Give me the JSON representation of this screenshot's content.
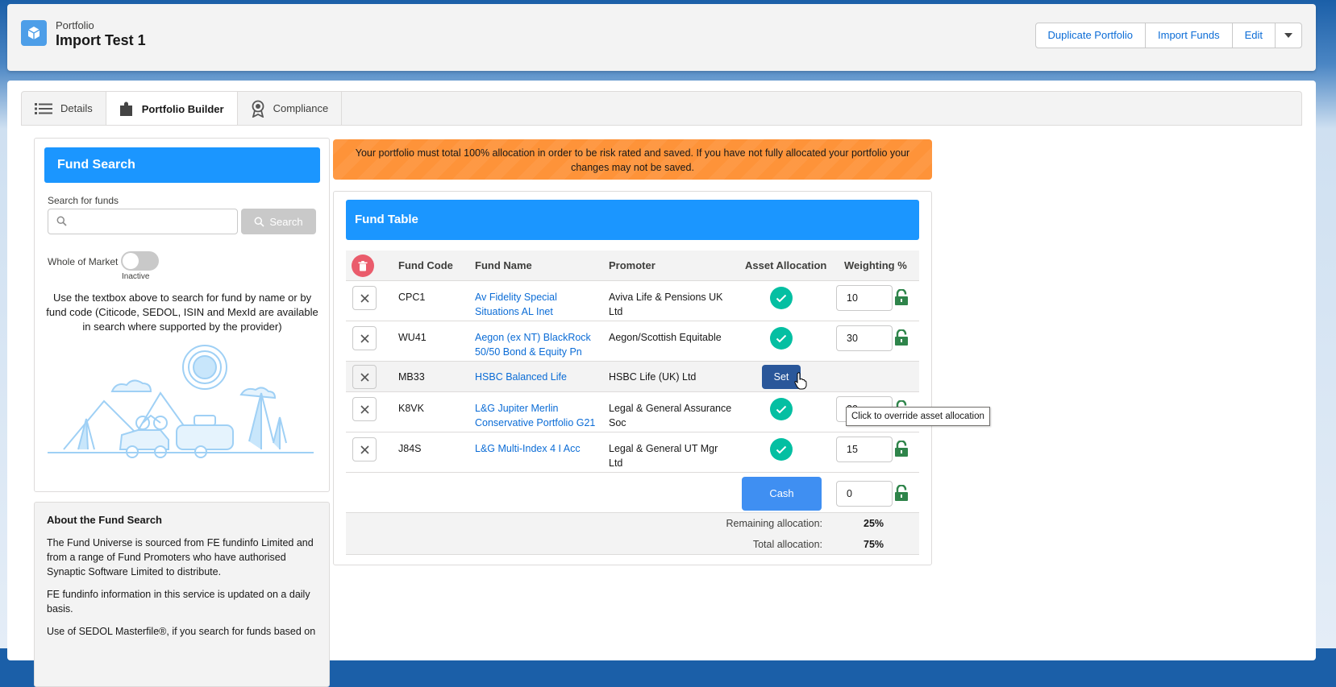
{
  "header": {
    "object_type": "Portfolio",
    "title": "Import Test 1",
    "actions": [
      "Duplicate Portfolio",
      "Import Funds",
      "Edit"
    ]
  },
  "tabs": [
    {
      "label": "Details",
      "icon": "list-icon"
    },
    {
      "label": "Portfolio Builder",
      "icon": "puzzle-icon",
      "active": true
    },
    {
      "label": "Compliance",
      "icon": "award-icon"
    }
  ],
  "fund_search": {
    "title": "Fund Search",
    "search_label": "Search for funds",
    "search_value": "",
    "search_button": "Search",
    "whole_of_market_label": "Whole of Market",
    "toggle_state": "Inactive",
    "help_text": "Use the textbox above to search for fund by name or by fund code (Citicode, SEDOL, ISIN and MexId are available in search where supported by the provider)"
  },
  "about": {
    "title": "About the Fund Search",
    "paragraphs": [
      "The Fund Universe is sourced from FE fundinfo Limited and from a range of Fund Promoters who have authorised Synaptic Software Limited to distribute.",
      "FE fundinfo information in this service is updated on a daily basis.",
      "Use of SEDOL Masterfile®, if you search for funds based on"
    ]
  },
  "warning": "Your portfolio must total 100% allocation in order to be risk rated and saved. If you have not fully allocated your portfolio your changes may not be saved.",
  "fund_table": {
    "title": "Fund Table",
    "columns": [
      "Fund Code",
      "Fund Name",
      "Promoter",
      "Asset Allocation",
      "Weighting %"
    ],
    "rows": [
      {
        "code": "CPC1",
        "name": "Av Fidelity Special Situations AL Inet",
        "promoter": "Aviva Life & Pensions UK Ltd",
        "allocation": "check",
        "weighting": "10"
      },
      {
        "code": "WU41",
        "name": "Aegon (ex NT) BlackRock 50/50 Bond & Equity Pn",
        "promoter": "Aegon/Scottish Equitable",
        "allocation": "check",
        "weighting": "30"
      },
      {
        "code": "MB33",
        "name": "HSBC Balanced Life",
        "promoter": "HSBC Life (UK) Ltd",
        "allocation": "Set",
        "weighting": ""
      },
      {
        "code": "K8VK",
        "name": "L&G Jupiter Merlin Conservative Portfolio G21",
        "promoter": "Legal & General Assurance Soc",
        "allocation": "check",
        "weighting": "20"
      },
      {
        "code": "J84S",
        "name": "L&G Multi-Index 4 I Acc",
        "promoter": "Legal & General UT Mgr Ltd",
        "allocation": "check",
        "weighting": "15"
      }
    ],
    "cash_label": "Cash",
    "cash_value": "0",
    "remaining_label": "Remaining allocation:",
    "remaining_value": "25%",
    "total_label": "Total allocation:",
    "total_value": "75%",
    "tooltip": "Click to override asset allocation"
  },
  "colors": {
    "brand_blue": "#1b96ff",
    "warning": "#fe9339",
    "check": "#04bfa2",
    "lock": "#2e844a"
  }
}
